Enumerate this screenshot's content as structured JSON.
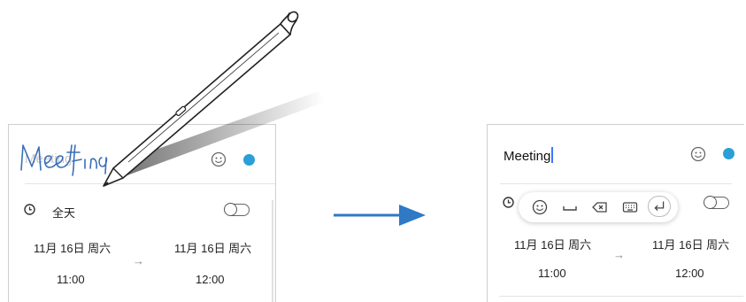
{
  "left": {
    "title_placeholder": "Meeting",
    "allday_label": "全天",
    "start_date": "11月 16日 周六",
    "start_time": "11:00",
    "end_date": "11月 16日 周六",
    "end_time": "12:00",
    "arrow": "→"
  },
  "right": {
    "title_text": "Meeting",
    "start_date": "11月 16日 周六",
    "start_time": "11:00",
    "end_date": "11月 16日 周六",
    "end_time": "12:00",
    "arrow": "→",
    "toolbar": [
      "emoji-icon",
      "space-icon",
      "backspace-icon",
      "keyboard-icon",
      "enter-icon"
    ]
  },
  "colors": {
    "accent": "#2a9fd8",
    "arrow": "#2f79c5",
    "ink": "#3b6fb8"
  }
}
